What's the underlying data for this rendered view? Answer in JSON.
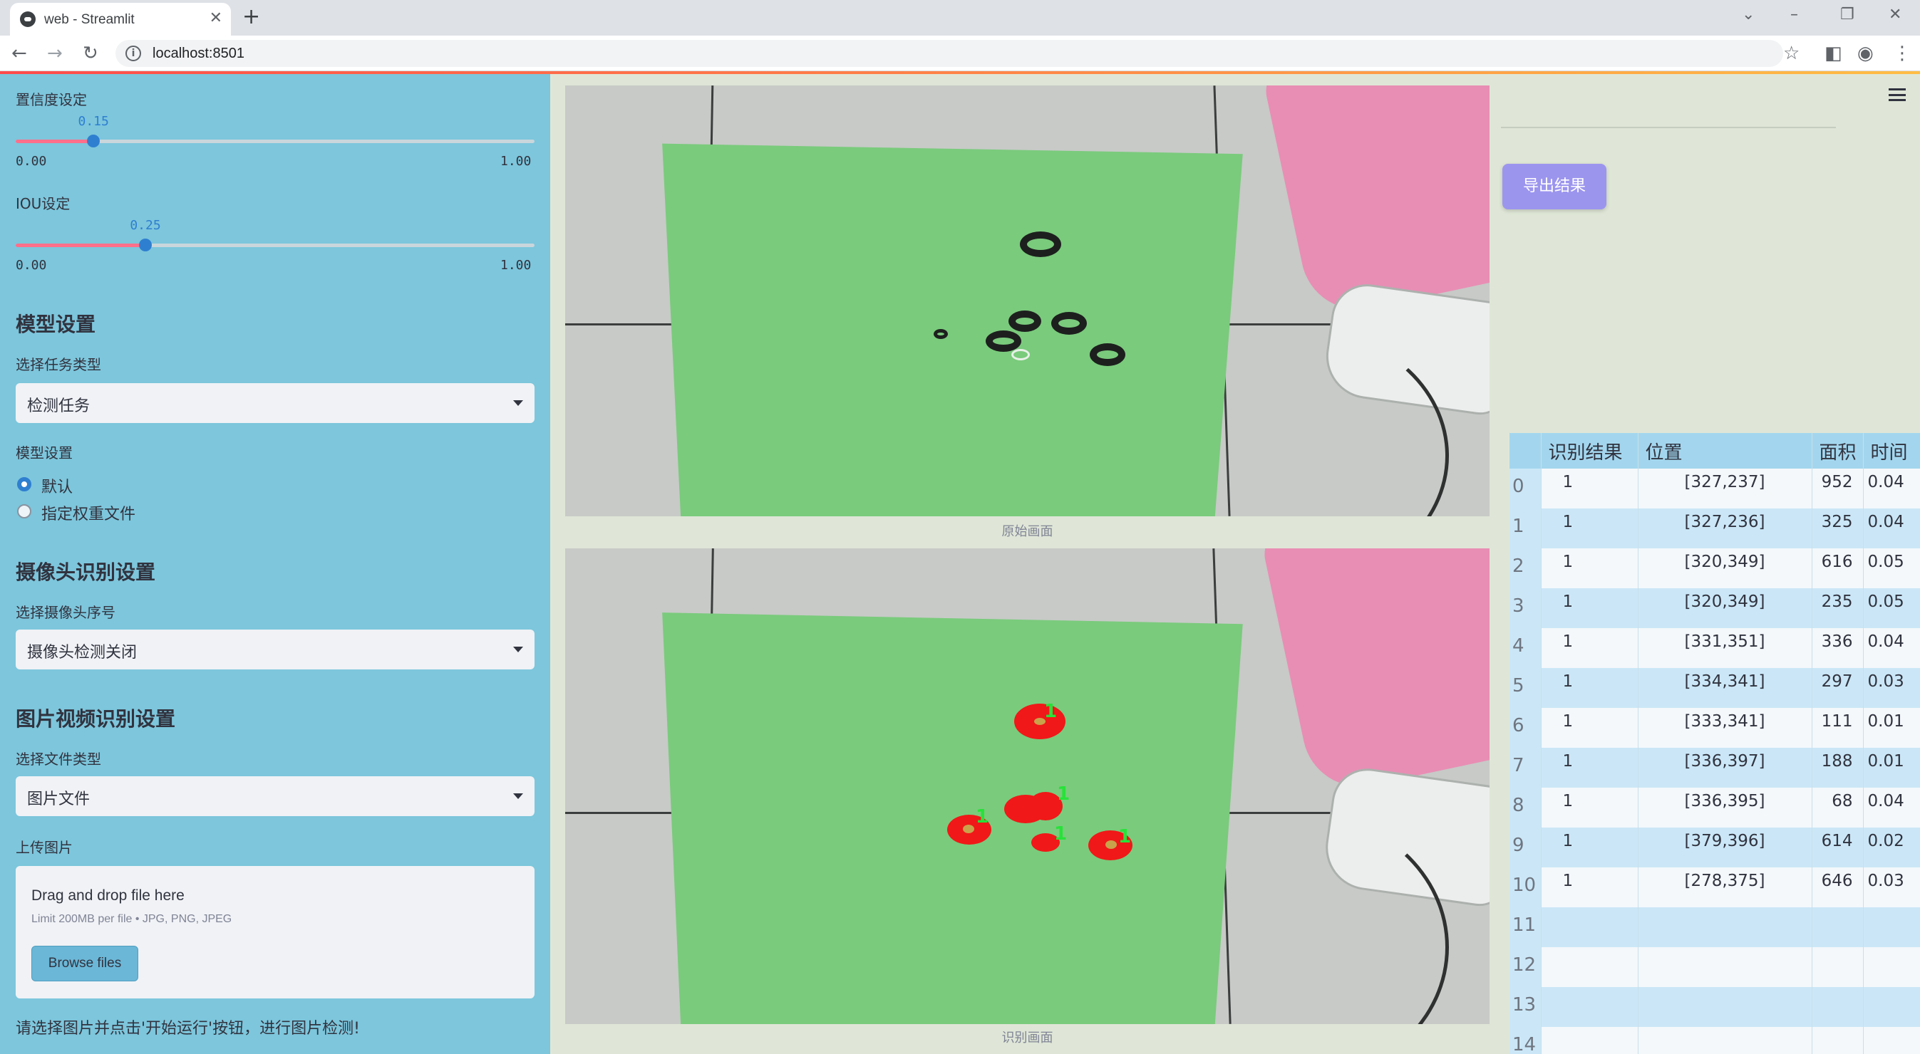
{
  "browser": {
    "tab_title": "web - Streamlit",
    "url": "localhost:8501"
  },
  "sidebar": {
    "confidence": {
      "label": "置信度设定",
      "value": "0.15",
      "min": "0.00",
      "max": "1.00",
      "fraction": 0.15
    },
    "iou": {
      "label": "IOU设定",
      "value": "0.25",
      "min": "0.00",
      "max": "1.00",
      "fraction": 0.25
    },
    "model_section": {
      "heading": "模型设置",
      "task_label": "选择任务类型",
      "task_value": "检测任务",
      "model_label": "模型设置",
      "options": [
        {
          "label": "默认",
          "selected": true
        },
        {
          "label": "指定权重文件",
          "selected": false
        }
      ]
    },
    "camera_section": {
      "heading": "摄像头识别设置",
      "camera_label": "选择摄像头序号",
      "camera_value": "摄像头检测关闭"
    },
    "media_section": {
      "heading": "图片视频识别设置",
      "file_type_label": "选择文件类型",
      "file_type_value": "图片文件",
      "upload_label": "上传图片",
      "drop_title": "Drag and drop file here",
      "drop_limit": "Limit 200MB per file • JPG, PNG, JPEG",
      "browse_label": "Browse files"
    },
    "hint": "请选择图片并点击'开始运行'按钮，进行图片检测!"
  },
  "main": {
    "original_caption": "原始画面",
    "result_caption": "识别画面",
    "detection_class_label": "1"
  },
  "right_panel": {
    "export_label": "导出结果",
    "table": {
      "headers": [
        "",
        "识别结果",
        "位置",
        "面积",
        "时间"
      ],
      "rows": [
        {
          "idx": "0",
          "result": "1",
          "pos": "[327,237]",
          "area": "952",
          "time": "0.04"
        },
        {
          "idx": "1",
          "result": "1",
          "pos": "[327,236]",
          "area": "325",
          "time": "0.04"
        },
        {
          "idx": "2",
          "result": "1",
          "pos": "[320,349]",
          "area": "616",
          "time": "0.05"
        },
        {
          "idx": "3",
          "result": "1",
          "pos": "[320,349]",
          "area": "235",
          "time": "0.05"
        },
        {
          "idx": "4",
          "result": "1",
          "pos": "[331,351]",
          "area": "336",
          "time": "0.04"
        },
        {
          "idx": "5",
          "result": "1",
          "pos": "[334,341]",
          "area": "297",
          "time": "0.03"
        },
        {
          "idx": "6",
          "result": "1",
          "pos": "[333,341]",
          "area": "111",
          "time": "0.01"
        },
        {
          "idx": "7",
          "result": "1",
          "pos": "[336,397]",
          "area": "188",
          "time": "0.01"
        },
        {
          "idx": "8",
          "result": "1",
          "pos": "[336,395]",
          "area": "68",
          "time": "0.04"
        },
        {
          "idx": "9",
          "result": "1",
          "pos": "[379,396]",
          "area": "614",
          "time": "0.02"
        },
        {
          "idx": "10",
          "result": "1",
          "pos": "[278,375]",
          "area": "646",
          "time": "0.03"
        },
        {
          "idx": "11",
          "result": "",
          "pos": "",
          "area": "",
          "time": ""
        },
        {
          "idx": "12",
          "result": "",
          "pos": "",
          "area": "",
          "time": ""
        },
        {
          "idx": "13",
          "result": "",
          "pos": "",
          "area": "",
          "time": ""
        },
        {
          "idx": "14",
          "result": "",
          "pos": "",
          "area": "",
          "time": ""
        }
      ]
    }
  },
  "colors": {
    "sidebar_bg": "#7dc6dc",
    "main_bg": "#dfe6d7",
    "accent_button": "#9c95ee",
    "slider_fill": "#ff6f8a",
    "slider_thumb": "#2f7fd0",
    "detection_mask": "#f01818",
    "detection_label": "#28e23a"
  },
  "icons": {
    "tab": "streamlit-logo-icon",
    "back": "arrow-left-icon",
    "forward": "arrow-right-icon",
    "reload": "reload-icon",
    "info": "info-icon",
    "star": "star-icon",
    "sidepanel": "side-panel-icon",
    "profile": "profile-icon",
    "menu": "kebab-menu-icon",
    "app_menu": "hamburger-menu-icon"
  }
}
